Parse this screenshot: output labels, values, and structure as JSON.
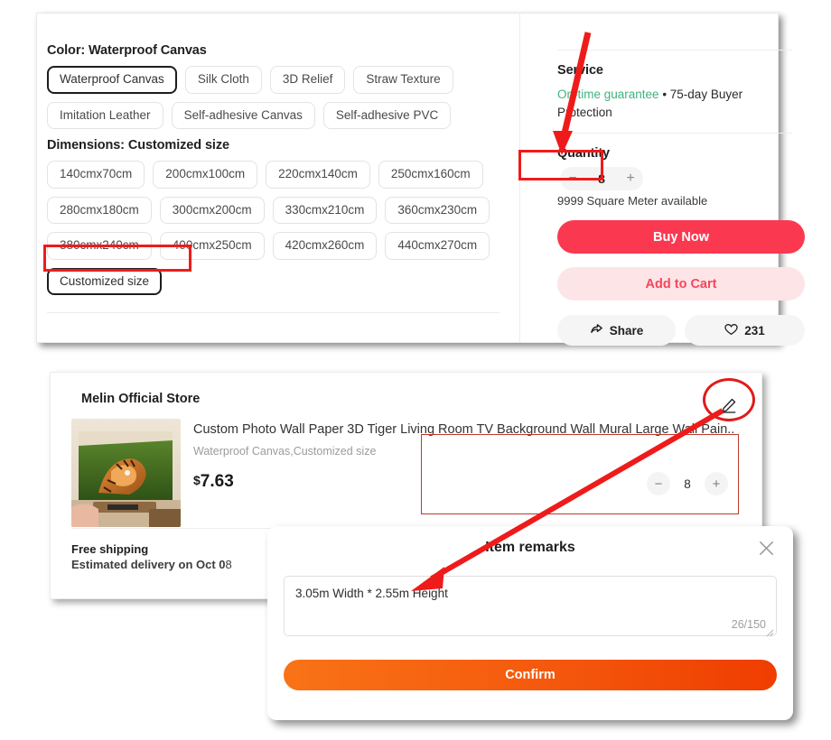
{
  "product_options": {
    "color": {
      "label": "Color: Waterproof Canvas",
      "selected": "Waterproof Canvas",
      "options": [
        "Waterproof Canvas",
        "Silk Cloth",
        "3D Relief",
        "Straw Texture",
        "Imitation Leather",
        "Self-adhesive Canvas",
        "Self-adhesive PVC"
      ]
    },
    "dimensions": {
      "label": "Dimensions: Customized size",
      "selected": "Customized size",
      "options": [
        "140cmx70cm",
        "200cmx100cm",
        "220cmx140cm",
        "250cmx160cm",
        "280cmx180cm",
        "300cmx200cm",
        "330cmx210cm",
        "360cmx230cm",
        "380cmx240cm",
        "400cmx250cm",
        "420cmx260cm",
        "440cmx270cm",
        "Customized size"
      ]
    }
  },
  "purchase_panel": {
    "service_title": "Service",
    "service_guarantee": "On-time guarantee",
    "service_rest": " • 75-day Buyer Protection",
    "quantity_title": "Quantity",
    "quantity_value": "8",
    "minus_label": "−",
    "plus_label": "+",
    "stock_text": "9999 Square Meter available",
    "buy_now_label": "Buy Now",
    "add_to_cart_label": "Add to Cart",
    "share_label": "Share",
    "like_count": "231"
  },
  "cart_card": {
    "store_name": "Melin Official Store",
    "product_title": "Custom Photo Wall Paper 3D Tiger Living Room TV Background Wall Mural Large Wall Pain...",
    "product_variant": "Waterproof Canvas,Customized size",
    "price_currency": "$",
    "price_amount": "7.63",
    "quantity_value": "8",
    "minus_label": "−",
    "plus_label": "+",
    "shipping_free": "Free shipping",
    "shipping_estimate_prefix": "Estimated delivery on ",
    "shipping_estimate_bold": "Oct 0",
    "shipping_estimate_tail": "8"
  },
  "modal": {
    "title": "Item remarks",
    "remark_value": "3.05m Width * 2.55m Height",
    "remark_placeholder": "Item remarks",
    "char_count": "26/150",
    "confirm_label": "Confirm"
  },
  "colors": {
    "accent_red": "#fa3950",
    "accent_red_soft": "#fde4e7",
    "service_green": "#3fb27f",
    "confirm_orange": "#f4580d",
    "annotation_red": "#ef1b1b"
  },
  "icons": {
    "edit": "pencil-icon",
    "close": "close-icon",
    "share": "share-icon",
    "heart": "heart-icon"
  }
}
